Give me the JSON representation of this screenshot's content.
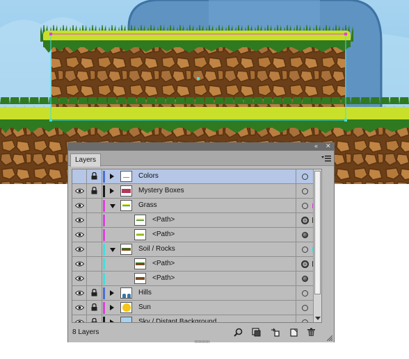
{
  "panel": {
    "tab_label": "Layers",
    "collapse_icon": "double-chevron-left-icon",
    "close_icon": "close-icon",
    "menu_icon": "panel-menu-icon",
    "layer_count_label": "8 Layers"
  },
  "layers": [
    {
      "name": "Colors",
      "visible": false,
      "locked": true,
      "color": "#4a6fd6",
      "expanded": false,
      "level": 0,
      "selected_row": true,
      "target": "hollow",
      "selection_color": null
    },
    {
      "name": "Mystery Boxes",
      "visible": true,
      "locked": true,
      "color": "#1a1a1a",
      "expanded": false,
      "level": 0,
      "selected_row": false,
      "target": "hollow",
      "selection_color": null
    },
    {
      "name": "Grass",
      "visible": true,
      "locked": false,
      "color": "#e040e0",
      "expanded": true,
      "level": 0,
      "selected_row": false,
      "target": "hollow",
      "selection_color": "#e040e0"
    },
    {
      "name": "<Path>",
      "visible": true,
      "locked": false,
      "color": "#e040e0",
      "expanded": null,
      "level": 1,
      "selected_row": false,
      "target": "ringed",
      "selection_color": "#e040e0"
    },
    {
      "name": "<Path>",
      "visible": true,
      "locked": false,
      "color": "#e040e0",
      "expanded": null,
      "level": 1,
      "selected_row": false,
      "target": "filled",
      "selection_color": null
    },
    {
      "name": "Soil / Rocks",
      "visible": true,
      "locked": false,
      "color": "#40e0e0",
      "expanded": true,
      "level": 0,
      "selected_row": false,
      "target": "hollow",
      "selection_color": "#40e0e0"
    },
    {
      "name": "<Path>",
      "visible": true,
      "locked": false,
      "color": "#40e0e0",
      "expanded": null,
      "level": 1,
      "selected_row": false,
      "target": "ringed",
      "selection_color": "#40e0e0"
    },
    {
      "name": "<Path>",
      "visible": true,
      "locked": false,
      "color": "#40e0e0",
      "expanded": null,
      "level": 1,
      "selected_row": false,
      "target": "filled",
      "selection_color": null
    },
    {
      "name": "Hills",
      "visible": true,
      "locked": true,
      "color": "#4a6fd6",
      "expanded": false,
      "level": 0,
      "selected_row": false,
      "target": "hollow",
      "selection_color": null
    },
    {
      "name": "Sun",
      "visible": true,
      "locked": true,
      "color": "#e040e0",
      "expanded": false,
      "level": 0,
      "selected_row": false,
      "target": "hollow",
      "selection_color": null
    },
    {
      "name": "Sky / Distant Background",
      "visible": true,
      "locked": true,
      "color": "#1a1a1a",
      "expanded": false,
      "level": 0,
      "selected_row": false,
      "target": "hollow",
      "selection_color": null
    }
  ],
  "footer_icons": [
    "locate-object-icon",
    "make-clipping-mask-icon",
    "create-sublayer-icon",
    "create-new-layer-icon",
    "trash-icon"
  ],
  "colors": {
    "sky": "#8ec6ea",
    "grass_light": "#c9e02a",
    "grass_dark": "#2f7a20",
    "soil": "#7a4a1e",
    "soil_rock": "#b57a3a",
    "selection_magenta": "#e040e0",
    "selection_cyan": "#40e0e0"
  }
}
